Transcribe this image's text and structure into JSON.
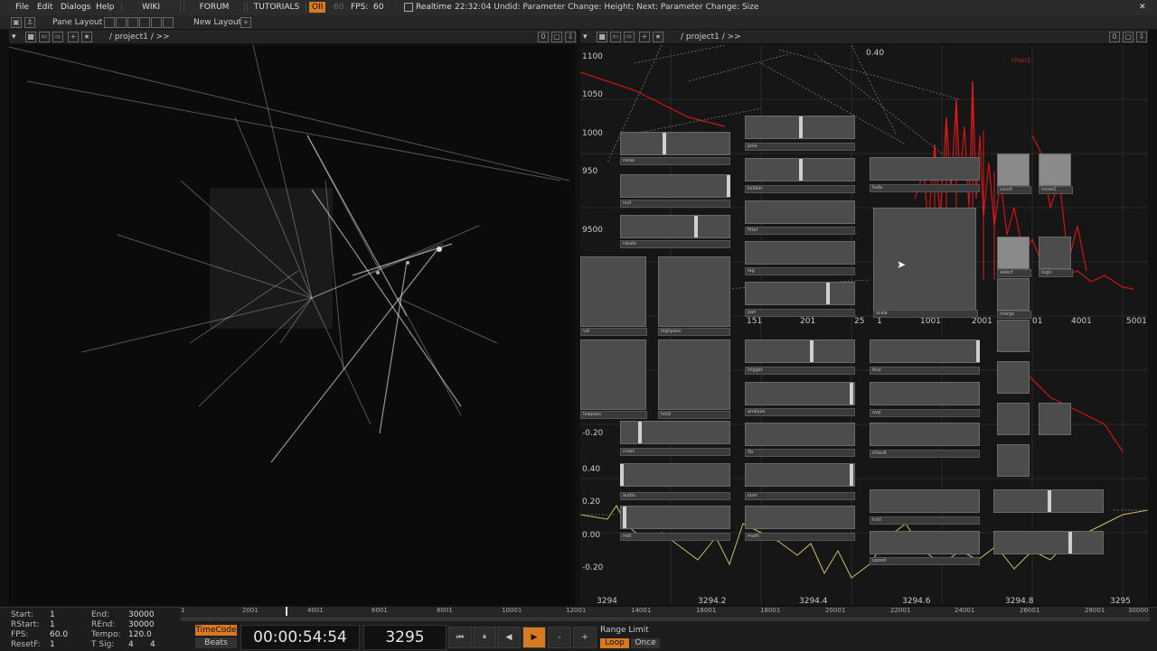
{
  "menu": {
    "items": [
      "File",
      "Edit",
      "Dialogs",
      "Help"
    ],
    "links": [
      "WIKI",
      "FORUM",
      "TUTORIALS"
    ],
    "oii": "OII",
    "sixty": "60",
    "fps_label": "FPS:",
    "fps_value": "60",
    "realtime": "Realtime",
    "status": "22:32:04 Undid: Parameter Change: Height; Next: Parameter Change: Size"
  },
  "layout": {
    "pane_layout": "Pane Layout",
    "new_layout": "New Layout",
    "plus": "+"
  },
  "pane_left": {
    "path": "/ project1 / >>",
    "num": "0"
  },
  "pane_right": {
    "path": "/ project1 / >>",
    "num": "0"
  },
  "network": {
    "y_axis_left": [
      "1100",
      "1050",
      "1000",
      "950",
      "9500"
    ],
    "y_axis_lower": [
      "-0.20",
      "0.40",
      "0.20",
      "0.00",
      "-0.20"
    ],
    "top_label": "0.40",
    "x_axis_mid": [
      "151",
      "201",
      "25",
      "1",
      "1001",
      "2001",
      "01",
      "4001",
      "5001"
    ],
    "x_axis_bottom": [
      "3294",
      "3294.2",
      "3294.4",
      "3294.6",
      "3294.8",
      "3295"
    ],
    "nodes": [
      "noise",
      "null",
      "rotate",
      "cross",
      "audio",
      "mid",
      "vol",
      "highpass",
      "lowpass",
      "hold",
      "pole",
      "kslider",
      "filter",
      "lag",
      "pan",
      "trigger",
      "analyze",
      "lfo",
      "sum",
      "math",
      "fade",
      "scale",
      "blur",
      "avg",
      "chanA",
      "trail",
      "speed",
      "count",
      "noise2",
      "select",
      "logic",
      "merge"
    ],
    "chart_label": "chan1"
  },
  "bottom": {
    "labels": {
      "start": "Start:",
      "rstart": "RStart:",
      "fps": "FPS:",
      "resetf": "ResetF:",
      "end": "End:",
      "rend": "REnd:",
      "tempo": "Tempo:",
      "tsig": "T Sig:"
    },
    "values": {
      "start": "1",
      "rstart": "1",
      "fps": "60.0",
      "resetf": "1",
      "end": "30000",
      "rend": "30000",
      "tempo": "120.0",
      "tsig_a": "4",
      "tsig_b": "4"
    },
    "ruler": [
      "1",
      "2001",
      "4001",
      "6001",
      "8001",
      "10001",
      "12001",
      "14001",
      "16001",
      "18001",
      "20001",
      "22001",
      "24001",
      "26001",
      "28001",
      "30000"
    ],
    "timecode_btn": "TimeCode",
    "beats_btn": "Beats",
    "timecode": "00:00:54:54",
    "frame": "3295",
    "controls": [
      "⏮",
      "⏸",
      "◀",
      "▶",
      "-",
      "+"
    ],
    "range_limit": "Range Limit",
    "loop": "Loop",
    "once": "Once"
  }
}
